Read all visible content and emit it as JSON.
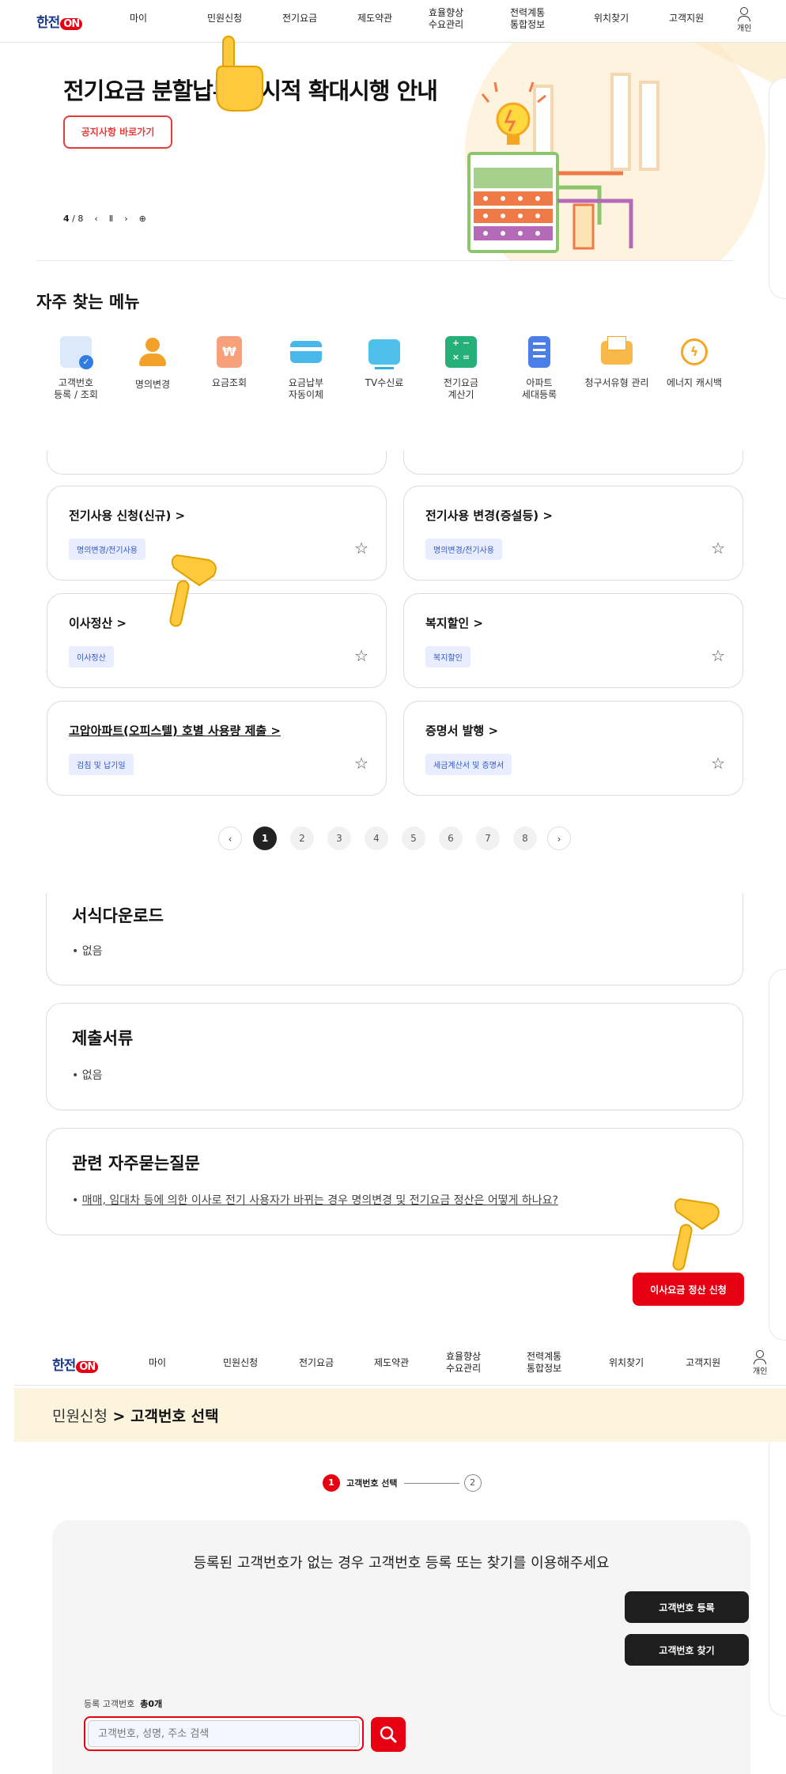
{
  "nav": {
    "logo_text": "한전",
    "logo_badge": "ON",
    "items": [
      "마이",
      "민원신청",
      "전기요금",
      "제도약관",
      "효율향상\n수요관리",
      "전력계통\n통합정보",
      "위치찾기",
      "고객지원"
    ],
    "user_label": "개인"
  },
  "hero": {
    "title": "전기요금 분할납부 한시적 확대시행 안내",
    "button": "공지사항 바로가기",
    "page_current": "4",
    "page_total": "/ 8"
  },
  "frequent": {
    "title": "자주 찾는 메뉴",
    "items": [
      {
        "label": "고객번호\n등록 / 조회",
        "icon": "document-check-icon",
        "color": "#2f7de1"
      },
      {
        "label": "명의변경",
        "icon": "person-edit-icon",
        "color": "#f2a229"
      },
      {
        "label": "요금조회",
        "icon": "bill-won-icon",
        "color": "#f07a47"
      },
      {
        "label": "요금납부\n자동이체",
        "icon": "credit-card-icon",
        "color": "#2fa8e0"
      },
      {
        "label": "TV수신료",
        "icon": "tv-icon",
        "color": "#2fb0e0"
      },
      {
        "label": "전기요금\n계산기",
        "icon": "calculator-icon",
        "color": "#25b07a"
      },
      {
        "label": "아파트\n세대등록",
        "icon": "apartment-icon",
        "color": "#3a6fe0"
      },
      {
        "label": "청구서유형 관리",
        "icon": "envelope-icon",
        "color": "#f5a623"
      },
      {
        "label": "에너지 캐시백",
        "icon": "energy-cashback-icon",
        "color": "#f5a623"
      }
    ]
  },
  "services": [
    {
      "title": "전기사용 신청(신규) >",
      "tag": "명의변경/전기사용",
      "underline": false
    },
    {
      "title": "전기사용 변경(증설등) >",
      "tag": "명의변경/전기사용",
      "underline": false
    },
    {
      "title": "이사정산 >",
      "tag": "이사정산",
      "underline": false
    },
    {
      "title": "복지할인 >",
      "tag": "복지할인",
      "underline": false
    },
    {
      "title": "고압아파트(오피스텔) 호별 사용량 제출 >",
      "tag": "검침 및 납기일",
      "underline": true
    },
    {
      "title": "증명서 발행 >",
      "tag": "세금계산서 및 증명서",
      "underline": false
    }
  ],
  "pagination": {
    "prev": "‹",
    "pages": [
      "1",
      "2",
      "3",
      "4",
      "5",
      "6",
      "7",
      "8"
    ],
    "next": "›",
    "current": "1"
  },
  "forms": {
    "title": "서식다운로드",
    "body": "• 없음"
  },
  "documents": {
    "title": "제출서류",
    "body": "• 없음"
  },
  "faq": {
    "title": "관련 자주묻는질문",
    "bullet": "• ",
    "link": "매매, 임대차 등에 의한 이사로 전기 사용자가 바뀌는 경우 명의변경 및 전기요금 정산은 어떻게 하나요?"
  },
  "apply_button": "이사요금 정산 신청",
  "breadcrumb": {
    "parent": "민원신청",
    "sep": " > ",
    "current": "고객번호 선택"
  },
  "steps": {
    "step1_num": "1",
    "step1_label": "고객번호 선택",
    "step2_num": "2"
  },
  "customer_panel": {
    "message": "등록된 고객번호가 없는 경우 고객번호 등록 또는 찾기를 이용해주세요",
    "register_button": "고객번호 등록",
    "find_button": "고객번호 찾기",
    "count_label": "등록 고객번호",
    "count_value": "총0개",
    "search_placeholder": "고객번호, 성명, 주소 검색"
  },
  "colors": {
    "accent": "#e60012",
    "brand": "#1a3a8a",
    "tag_bg": "#e8edff",
    "crumb_bg": "#fdf4dd"
  }
}
